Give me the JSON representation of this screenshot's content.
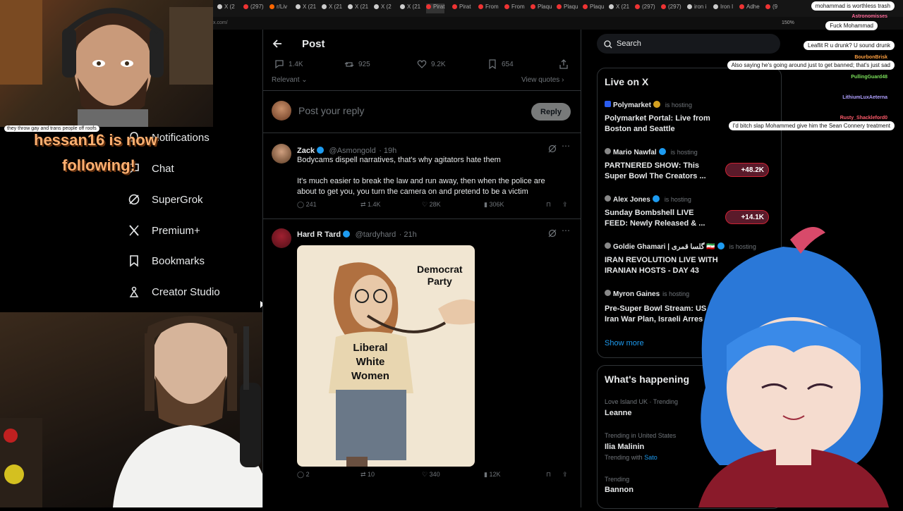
{
  "browser": {
    "tabs": [
      "X (2",
      "(297)",
      "r/Liv",
      "X (21",
      "X (21",
      "X (21",
      "X (2",
      "X (21",
      "Pirat",
      "Pirat",
      "From",
      "From",
      "Plaqu",
      "Plaqu",
      "Plaqu",
      "X (21",
      "(297)",
      "(297)",
      "iron i",
      "Iron I",
      "Adhe",
      "(9"
    ],
    "tab_colors": [
      "#ccc",
      "#e33",
      "#f60",
      "#ccc",
      "#ccc",
      "#ccc",
      "#ccc",
      "#ccc",
      "#e33",
      "#e33",
      "#e33",
      "#e33",
      "#e33",
      "#e33",
      "#e33",
      "#ccc",
      "#e33",
      "#e33",
      "#ccc",
      "#ccc",
      "#e33",
      "#e33"
    ],
    "address_left": "x.com/",
    "zoom": "150%"
  },
  "nav": {
    "items": [
      {
        "label": "Notifications",
        "icon": "bell-icon"
      },
      {
        "label": "Chat",
        "icon": "chat-icon"
      },
      {
        "label": "SuperGrok",
        "icon": "grok-icon"
      },
      {
        "label": "Premium+",
        "icon": "x-logo-icon"
      },
      {
        "label": "Bookmarks",
        "icon": "bookmark-icon"
      },
      {
        "label": "Creator Studio",
        "icon": "creator-studio-icon"
      }
    ]
  },
  "post": {
    "title": "Post",
    "stats": {
      "replies": "1.4K",
      "reposts": "925",
      "likes": "9.2K",
      "bookmarks": "654"
    },
    "sort": "Relevant",
    "view_quotes": "View quotes",
    "reply_placeholder": "Post your reply",
    "reply_button": "Reply"
  },
  "replies": [
    {
      "name": "Zack",
      "handle": "@Asmongold",
      "time": "· 19h",
      "lines": [
        "Bodycams dispell narratives, that's why agitators hate them",
        "",
        "It's much easier to break the law and run away, then when the police are",
        "about to get you, you turn the camera on and pretend to be a victim"
      ],
      "actions": {
        "replies": "241",
        "reposts": "1.4K",
        "likes": "28K",
        "views": "306K"
      }
    },
    {
      "name": "Hard R Tard",
      "handle": "@tardyhard",
      "time": "· 21h",
      "image_text": {
        "top": "Democrat",
        "top2": "Party",
        "shirt": [
          "Liberal",
          "White",
          "Women"
        ]
      },
      "actions": {
        "replies": "2",
        "reposts": "10",
        "likes": "340",
        "views": "12K"
      }
    }
  ],
  "sidebar": {
    "search_placeholder": "Search",
    "live_title": "Live on X",
    "hosting": "is hosting",
    "hosts": [
      {
        "name": "Polymarket",
        "title": "Polymarket Portal: Live from Boston and Seattle"
      },
      {
        "name": "Mario Nawfal",
        "title": "PARTNERED SHOW: This Super Bowl The Creators ..."
      },
      {
        "name": "Alex Jones",
        "title": "Sunday Bombshell LIVE FEED: Newly Released & ..."
      },
      {
        "name": "Goldie Ghamari | گلسا قمری 🇮🇷",
        "title": "IRAN REVOLUTION LIVE WITH IRANIAN HOSTS - DAY 43"
      },
      {
        "name": "Myron Gaines",
        "title": "Pre-Super Bowl Stream: US Iran War Plan, Israeli Arres"
      }
    ],
    "show_more": "Show more",
    "whats_happening": "What's happening",
    "trends": [
      {
        "context": "Love Island UK · Trending",
        "name": "Leanne"
      },
      {
        "context": "Trending in United States",
        "name": "Ilia Malinin",
        "sub": "Trending with",
        "sub_link": "Sato"
      },
      {
        "context": "Trending",
        "name": "Bannon"
      }
    ]
  },
  "live_counts": [
    "+48.2K",
    "+14.1K"
  ],
  "stream_overlay": {
    "follow_lines": [
      "hessan16 is now",
      "following!"
    ],
    "caption": "they throw gay and trans people off roofs"
  },
  "chat": [
    {
      "name": "",
      "msg": "mohammad is worthless trash"
    },
    {
      "name": "Astronomisses",
      "msg": "Fuck Mohammad"
    },
    {
      "name": "",
      "msg": "Leaflit R u drunk? U sound drunk"
    },
    {
      "name": "BourbonBrisk",
      "msg": "Also saying he's going around just to get banned; that's just sad"
    },
    {
      "name": "PullingGuard48",
      "msg": ""
    },
    {
      "name": "LithiumLuxAeterna",
      "msg": ""
    },
    {
      "name": "Rusty_Shackleford0",
      "msg": "I'd bitch slap Mohammed give him the Sean Connery treatment"
    }
  ],
  "colors": {
    "accent": "#1d9bf0",
    "bg": "#000000",
    "muted": "#71767b",
    "border": "#2f3336"
  }
}
